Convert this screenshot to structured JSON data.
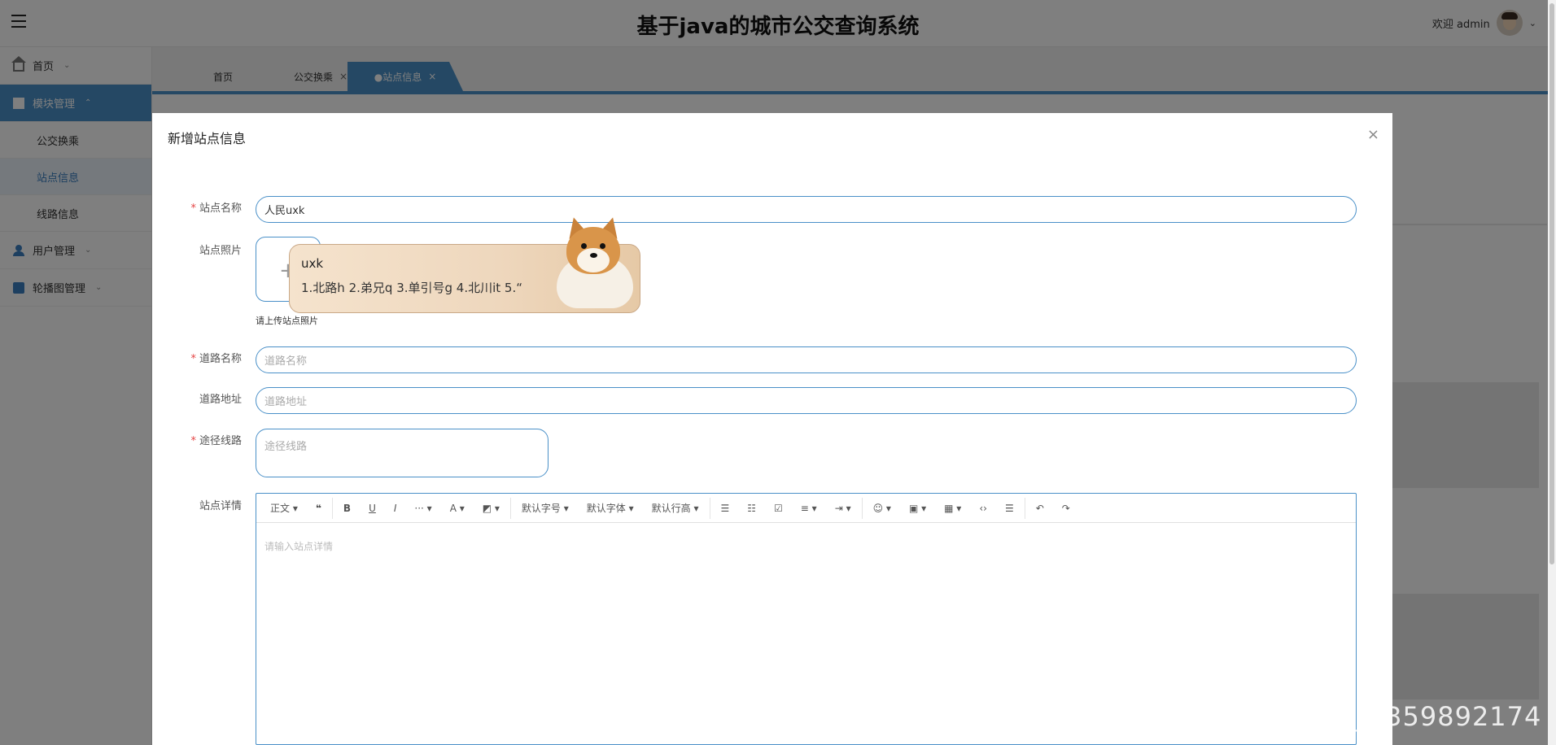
{
  "header": {
    "title": "基于java的城市公交查询系统",
    "welcome": "欢迎 admin"
  },
  "sidebar": {
    "items": [
      {
        "label": "首页",
        "icon": "home-icon"
      },
      {
        "label": "模块管理",
        "icon": "module-icon",
        "expanded": true
      },
      {
        "label": "公交换乘"
      },
      {
        "label": "站点信息"
      },
      {
        "label": "线路信息"
      },
      {
        "label": "用户管理",
        "icon": "user-icon"
      },
      {
        "label": "轮播图管理",
        "icon": "carousel-icon"
      }
    ]
  },
  "tabs": [
    {
      "label": "首页"
    },
    {
      "label": "公交换乘",
      "close": "×"
    },
    {
      "label": "●站点信息",
      "close": "×"
    }
  ],
  "dialog": {
    "title": "新增站点信息",
    "close": "×",
    "fields": {
      "name_label": "站点名称",
      "name_value": "人民uxk",
      "photo_label": "站点照片",
      "photo_tip": "请上传站点照片",
      "road_label": "道路名称",
      "road_placeholder": "道路名称",
      "addr_label": "道路地址",
      "addr_placeholder": "道路地址",
      "route_label": "途径线路",
      "route_placeholder": "途径线路",
      "detail_label": "站点详情",
      "detail_placeholder": "请输入站点详情"
    },
    "required_mark": "*"
  },
  "editor_toolbar": {
    "heading": "正文",
    "font_size": "默认字号",
    "font_family": "默认字体",
    "line_height": "默认行高"
  },
  "ime": {
    "input": "uxk",
    "candidates": "1.北路h  2.弟兄q  3.单引号g  4.北川it  5.“"
  },
  "watermark": "CSDN @QQ_3359892174",
  "colors": {
    "accent": "#4a90c8",
    "required": "#e54545"
  }
}
